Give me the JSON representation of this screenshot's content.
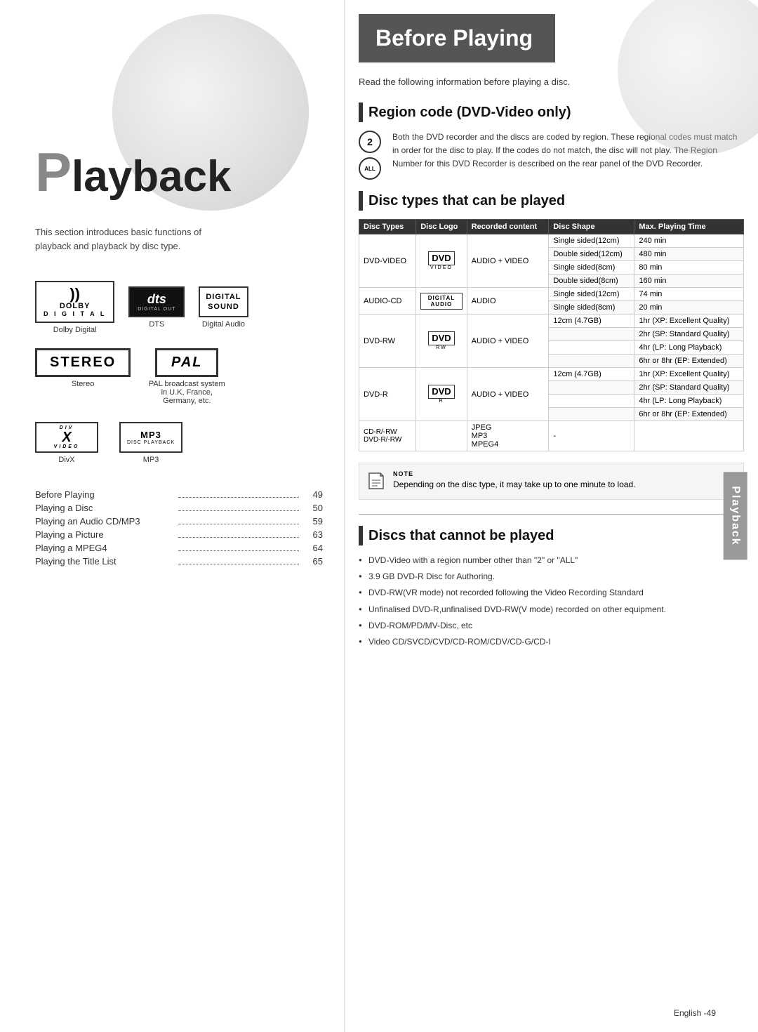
{
  "left": {
    "playback_title": "Playback",
    "playback_p": "P",
    "intro": "This section introduces basic functions of playback and playback by disc type.",
    "logos": {
      "dolby": {
        "symbol": ")))",
        "main": "DOLBY",
        "sub": "D I G I T A L",
        "label": "Dolby Digital"
      },
      "dts": {
        "main": "dts",
        "sub": "DIGITAL OUT",
        "label": "DTS"
      },
      "digital_sound": {
        "line1": "DIGITAL",
        "line2": "SOUND",
        "label": "Digital Audio"
      },
      "stereo": {
        "text": "STEREO",
        "label": "Stereo"
      },
      "pal": {
        "text": "PAL",
        "label": "PAL broadcast system in U.K, France, Germany, etc."
      },
      "divx": {
        "top": "DIV",
        "mid": "X",
        "bot": "VIDEO",
        "label": "DivX"
      },
      "mp3": {
        "text": "MP3",
        "sub": "DISC PLAYBACK",
        "label": "MP3"
      }
    },
    "toc": [
      {
        "title": "Before Playing",
        "page": "49"
      },
      {
        "title": "Playing a Disc",
        "page": "50"
      },
      {
        "title": "Playing an Audio CD/MP3",
        "page": "59"
      },
      {
        "title": "Playing a Picture",
        "page": "63"
      },
      {
        "title": "Playing a MPEG4",
        "page": "64"
      },
      {
        "title": "Playing the Title List",
        "page": "65"
      }
    ]
  },
  "right": {
    "header": "Before Playing",
    "intro_text": "Read the following information before playing a disc.",
    "region_code": {
      "title": "Region code (DVD-Video only)",
      "badge_num": "2",
      "badge_all": "ALL",
      "text": "Both the DVD recorder and the discs are coded by region. These regional codes must match in order for the disc to play. If the codes do not match, the disc will not play. The Region Number for this DVD Recorder is described on the rear panel of the DVD Recorder."
    },
    "disc_types": {
      "title": "Disc types that can be played",
      "columns": [
        "Disc Types",
        "Disc Logo",
        "Recorded content",
        "Disc Shape",
        "Max. Playing Time"
      ],
      "rows": [
        {
          "type": "DVD-VIDEO",
          "logo": "DVD VIDEO",
          "content": "AUDIO + VIDEO",
          "shapes": [
            {
              "shape": "Single sided(12cm)",
              "time": "240 min"
            },
            {
              "shape": "Double sided(12cm)",
              "time": "480 min"
            },
            {
              "shape": "Single sided(8cm)",
              "time": "80 min"
            },
            {
              "shape": "Double sided(8cm)",
              "time": "160 min"
            }
          ]
        },
        {
          "type": "AUDIO-CD",
          "logo": "DIGITAL AUDIO",
          "content": "AUDIO",
          "shapes": [
            {
              "shape": "Single sided(12cm)",
              "time": "74 min"
            },
            {
              "shape": "Single sided(8cm)",
              "time": "20 min"
            }
          ]
        },
        {
          "type": "DVD-RW",
          "logo": "DVD RW",
          "content": "AUDIO + VIDEO",
          "shapes": [
            {
              "shape": "12cm (4.7GB)",
              "time": "1hr (XP: Excellent Quality)"
            },
            {
              "shape": "",
              "time": "2hr (SP: Standard Quality)"
            },
            {
              "shape": "",
              "time": "4hr (LP: Long Playback)"
            },
            {
              "shape": "",
              "time": "6hr or 8hr (EP: Extended)"
            }
          ]
        },
        {
          "type": "DVD-R",
          "logo": "DVD R",
          "content": "AUDIO + VIDEO",
          "shapes": [
            {
              "shape": "12cm (4.7GB)",
              "time": "1hr (XP: Excellent Quality)"
            },
            {
              "shape": "",
              "time": "2hr (SP: Standard Quality)"
            },
            {
              "shape": "",
              "time": "4hr (LP: Long Playback)"
            },
            {
              "shape": "",
              "time": "6hr or 8hr (EP: Extended)"
            }
          ]
        },
        {
          "type": "CD-R/-RW\nDVD-R/-RW",
          "logo": "",
          "content": "JPEG\nMP3\nMPEG4",
          "shapes": [
            {
              "shape": "-",
              "time": ""
            }
          ]
        }
      ]
    },
    "note": {
      "icon": "✎",
      "label": "NOTE",
      "text": "Depending on the disc type, it may take up to one minute to load."
    },
    "cannot_play": {
      "title": "Discs that cannot be played",
      "items": [
        "DVD-Video with a region number other than \"2\" or \"ALL\"",
        "3.9 GB DVD-R Disc for Authoring.",
        "DVD-RW(VR mode) not recorded following the Video Recording Standard",
        "Unfinalised DVD-R,unfinalised DVD-RW(V mode) recorded on other equipment.",
        "DVD-ROM/PD/MV-Disc, etc",
        "Video CD/SVCD/CVD/CD-ROM/CDV/CD-G/CD-I"
      ]
    }
  },
  "sidebar_tab": "Playback",
  "footer": "English -49"
}
